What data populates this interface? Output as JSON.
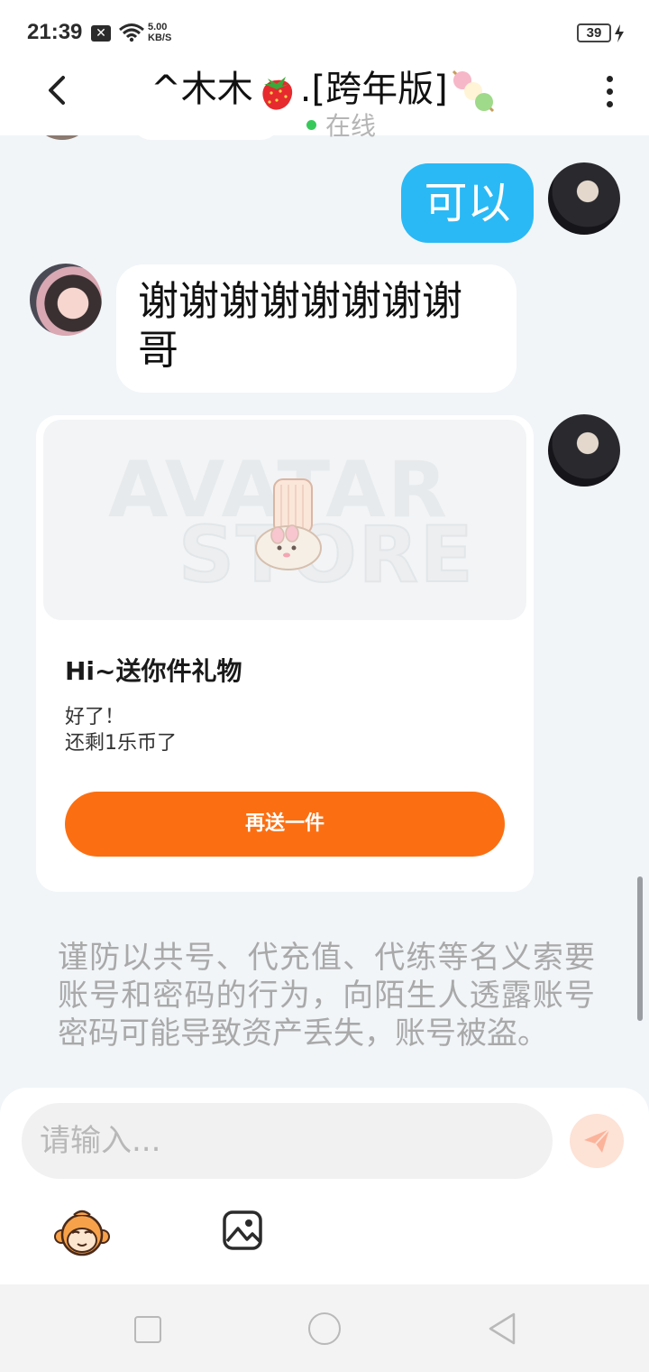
{
  "status_bar": {
    "time": "21:39",
    "notification_icon": "close-box-icon",
    "wifi_icon": "wifi-icon",
    "net_speed_value": "5.00",
    "net_speed_unit": "KB/S",
    "battery_level": "39",
    "charging_icon": "bolt-icon"
  },
  "header": {
    "title_prefix": "^木木",
    "title_suffix": ".[跨年版]",
    "online_status": "在线",
    "online_color": "#36c95a",
    "back_icon": "chevron-left-icon",
    "more_icon": "more-vertical-icon"
  },
  "messages": {
    "me_text": "可以",
    "her_text": "谢谢谢谢谢谢谢谢哥"
  },
  "gift_card": {
    "watermark_line1": "AVATAR",
    "watermark_line2": "STORE",
    "title": "Hi~送你件礼物",
    "message": "好了！\n还剩1乐币了",
    "button_label": "再送一件"
  },
  "warning": "谨防以共号、代充值、代练等名义索要账号和密码的行为，向陌生人透露账号密码可能导致资产丢失，账号被盗。",
  "input": {
    "placeholder": "请输入...",
    "send_icon": "send-icon",
    "emoji_icon": "monkey-emoji-icon",
    "image_icon": "image-icon"
  },
  "colors": {
    "my_bubble": "#2ab9f5",
    "gift_button": "#fb6f12",
    "background": "#f1f5f8"
  }
}
